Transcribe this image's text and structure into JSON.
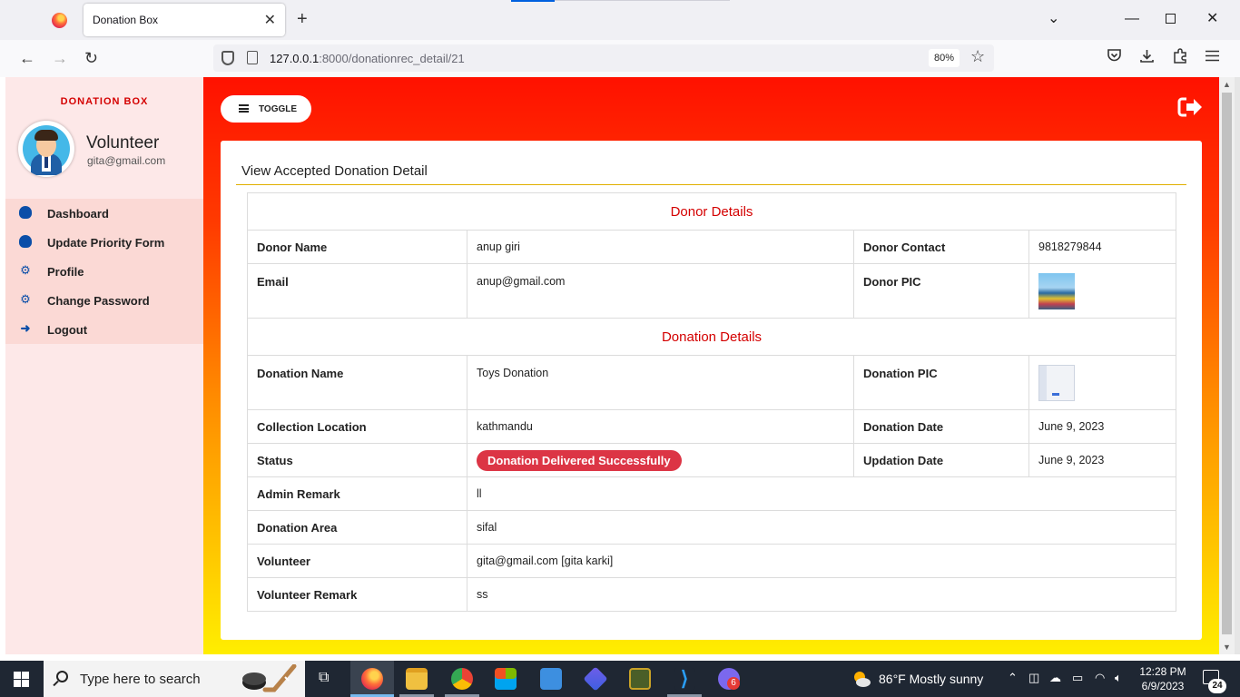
{
  "browser": {
    "tab_title": "Donation Box",
    "url_host": "127.0.0.1",
    "url_path": ":8000/donationrec_detail/21",
    "zoom": "80%"
  },
  "sidebar": {
    "brand": "DONATION BOX",
    "user_name": "Volunteer",
    "user_email": "gita@gmail.com",
    "items": [
      {
        "label": "Dashboard",
        "icon": "dashboard-icon"
      },
      {
        "label": "Update Priority Form",
        "icon": "dashboard-icon"
      },
      {
        "label": "Profile",
        "icon": "gear-icon"
      },
      {
        "label": "Change Password",
        "icon": "gear-icon"
      },
      {
        "label": "Logout",
        "icon": "sign-out-icon"
      }
    ]
  },
  "topbar": {
    "toggle_label": "TOGGLE"
  },
  "card": {
    "title": "View Accepted Donation Detail",
    "donor_section": "Donor Details",
    "donation_section": "Donation Details",
    "donor_name_label": "Donor Name",
    "donor_name": "anup giri",
    "donor_contact_label": "Donor Contact",
    "donor_contact": "9818279844",
    "email_label": "Email",
    "email": "anup@gmail.com",
    "donor_pic_label": "Donor PIC",
    "donation_name_label": "Donation Name",
    "donation_name": "Toys Donation",
    "donation_pic_label": "Donation PIC",
    "collection_location_label": "Collection Location",
    "collection_location": "kathmandu",
    "donation_date_label": "Donation Date",
    "donation_date": "June 9, 2023",
    "status_label": "Status",
    "status": "Donation Delivered Successfully",
    "updation_date_label": "Updation Date",
    "updation_date": "June 9, 2023",
    "admin_remark_label": "Admin Remark",
    "admin_remark": "ll",
    "donation_area_label": "Donation Area",
    "donation_area": "sifal",
    "volunteer_label": "Volunteer",
    "volunteer": "gita@gmail.com [gita karki]",
    "volunteer_remark_label": "Volunteer Remark",
    "volunteer_remark": "ss"
  },
  "taskbar": {
    "search_placeholder": "Type here to search",
    "weather": "86°F  Mostly sunny",
    "time": "12:28 PM",
    "date": "6/9/2023",
    "notification_count": "24",
    "teams_badge": "6"
  },
  "colors": {
    "accent_red": "#d40000",
    "status_badge": "#dc3545",
    "sidebar_icon": "#0a4ea8"
  }
}
